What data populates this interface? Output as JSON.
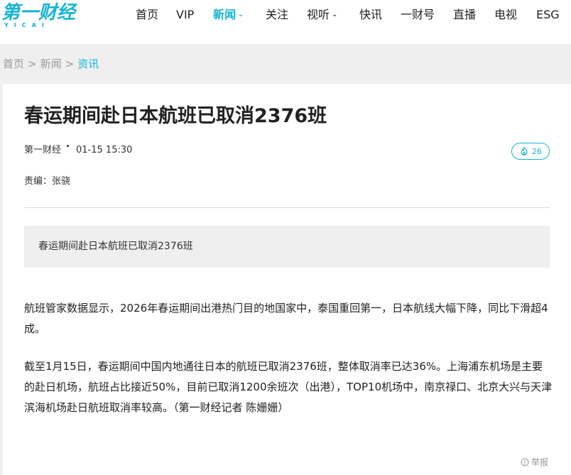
{
  "logo": {
    "main": "第一财经",
    "sub": "YICAI"
  },
  "nav": [
    {
      "label": "首页",
      "active": false,
      "has_dropdown": false
    },
    {
      "label": "VIP",
      "active": false,
      "has_dropdown": false
    },
    {
      "label": "新闻",
      "active": true,
      "has_dropdown": true
    },
    {
      "label": "关注",
      "active": false,
      "has_dropdown": false
    },
    {
      "label": "视听",
      "active": false,
      "has_dropdown": true
    },
    {
      "label": "快讯",
      "active": false,
      "has_dropdown": false
    },
    {
      "label": "一财号",
      "active": false,
      "has_dropdown": false
    },
    {
      "label": "直播",
      "active": false,
      "has_dropdown": false
    },
    {
      "label": "电视",
      "active": false,
      "has_dropdown": false
    },
    {
      "label": "ESG",
      "active": false,
      "has_dropdown": false
    }
  ],
  "breadcrumb": {
    "home": "首页",
    "sep": ">",
    "section": "新闻",
    "current": "资讯"
  },
  "article": {
    "title": "春运期间赴日本航班已取消2376班",
    "source": "第一财经",
    "time": "01-15 15:30",
    "hot_count": "26",
    "editor": "责编：张骁",
    "summary": "春运期间赴日本航班已取消2376班",
    "paragraphs": [
      "航班管家数据显示，2026年春运期间出港热门目的地国家中，泰国重回第一，日本航线大幅下降，同比下滑超4成。",
      "截至1月15日，春运期间中国内地通往日本的航班已取消2376班，整体取消率已达36%。上海浦东机场是主要的赴日机场，航班占比接近50%，目前已取消1200余班次（出港），TOP10机场中，南京禄口、北京大兴与天津滨海机场赴日航班取消率较高。（第一财经记者 陈姗姗）"
    ],
    "report_label": "举报"
  },
  "colors": {
    "accent": "#17b3d4",
    "background": "#efefef",
    "card": "#ffffff"
  },
  "icons": {
    "hot": "flame-icon",
    "report": "info-circle-icon",
    "dropdown": "chevron-down-icon"
  }
}
